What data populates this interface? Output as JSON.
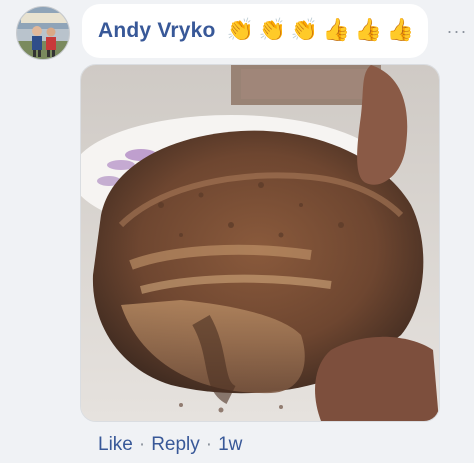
{
  "comment": {
    "author": "Andy Vryko",
    "reaction_emojis": [
      "👏",
      "👏",
      "👏",
      "👍",
      "👍",
      "👍"
    ],
    "more_icon": "more-horizontal-icon",
    "more_glyph": "···",
    "photo_description": "food-photo",
    "actions": {
      "like_label": "Like",
      "reply_label": "Reply",
      "separator": "·",
      "timestamp": "1w"
    }
  },
  "colors": {
    "background": "#f0f2f5",
    "bubble": "#ffffff",
    "link": "#385898",
    "muted": "#8d949e"
  }
}
